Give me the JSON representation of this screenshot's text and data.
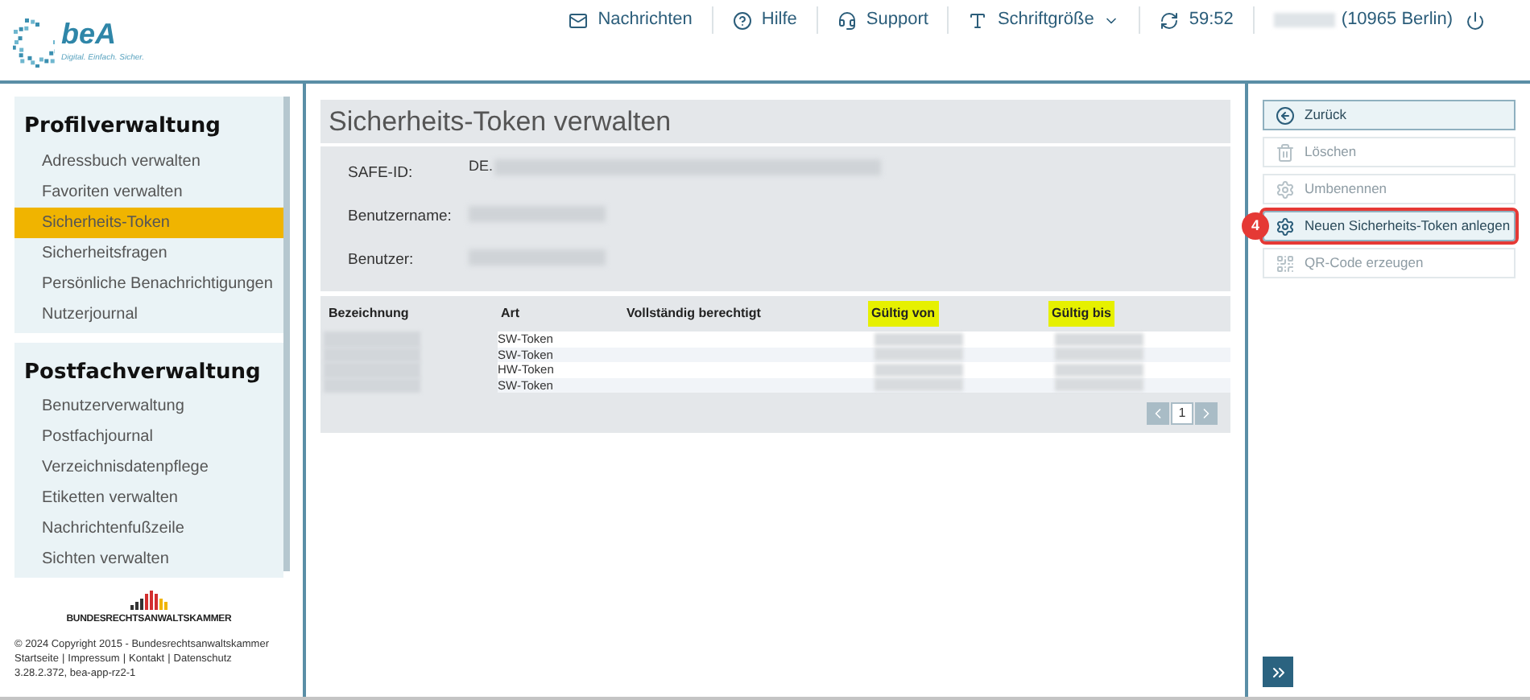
{
  "logo": {
    "name": "beA",
    "tagline": "Digital. Einfach. Sicher."
  },
  "topnav": [
    {
      "kind": "messages",
      "label": "Nachrichten"
    },
    {
      "kind": "help",
      "label": "Hilfe"
    },
    {
      "kind": "support",
      "label": "Support"
    },
    {
      "kind": "fontsize",
      "label": "Schriftgröße",
      "dropdown": true
    },
    {
      "kind": "timer",
      "label": "59:52"
    },
    {
      "kind": "user",
      "label": "(10965 Berlin)"
    }
  ],
  "sidebar": [
    {
      "title": "Profilverwaltung",
      "items": [
        {
          "label": "Adressbuch verwalten",
          "selected": false
        },
        {
          "label": "Favoriten verwalten",
          "selected": false
        },
        {
          "label": "Sicherheits-Token",
          "selected": true
        },
        {
          "label": "Sicherheitsfragen",
          "selected": false
        },
        {
          "label": "Persönliche Benachrichtigungen",
          "selected": false
        },
        {
          "label": "Nutzerjournal",
          "selected": false
        }
      ]
    },
    {
      "title": "Postfachverwaltung",
      "items": [
        {
          "label": "Benutzerverwaltung",
          "selected": false
        },
        {
          "label": "Postfachjournal",
          "selected": false
        },
        {
          "label": "Verzeichnisdatenpflege",
          "selected": false
        },
        {
          "label": "Etiketten verwalten",
          "selected": false
        },
        {
          "label": "Nachrichtenfußzeile",
          "selected": false
        },
        {
          "label": "Sichten verwalten",
          "selected": false
        }
      ]
    }
  ],
  "footer": {
    "org": "BUNDESRECHTSANWALTSKAMMER",
    "copyright": "© 2024 Copyright 2015 - Bundesrechtsanwaltskammer",
    "links": [
      "Startseite",
      "Impressum",
      "Kontakt",
      "Datenschutz"
    ],
    "separator": "|",
    "version": "3.28.2.372, bea-app-rz2-1"
  },
  "page": {
    "title": "Sicherheits-Token verwalten",
    "fields": [
      {
        "label": "SAFE-ID:",
        "value": "DE."
      },
      {
        "label": "Benutzername:"
      },
      {
        "label": "Benutzer:"
      }
    ]
  },
  "table": {
    "columns": [
      {
        "label": "Bezeichnung",
        "highlighted": false
      },
      {
        "label": "Art",
        "highlighted": false
      },
      {
        "label": "Vollständig berechtigt",
        "highlighted": false
      },
      {
        "label": "Gültig von",
        "highlighted": true
      },
      {
        "label": "Gültig bis",
        "highlighted": true
      }
    ],
    "rows": [
      {
        "art": "SW-Token"
      },
      {
        "art": "SW-Token"
      },
      {
        "art": "HW-Token"
      },
      {
        "art": "SW-Token"
      }
    ],
    "pagination": {
      "page": "1"
    }
  },
  "actions": [
    {
      "kind": "back",
      "label": "Zurück",
      "disabled": false,
      "highlighted": false
    },
    {
      "kind": "delete",
      "label": "Löschen",
      "disabled": true,
      "highlighted": false
    },
    {
      "kind": "gear",
      "label": "Umbenennen",
      "disabled": true,
      "highlighted": false
    },
    {
      "kind": "gear",
      "label": "Neuen Sicherheits-Token anlegen",
      "disabled": false,
      "highlighted": true,
      "callout": "4"
    },
    {
      "kind": "qr",
      "label": "QR-Code erzeugen",
      "disabled": true,
      "highlighted": false
    }
  ]
}
